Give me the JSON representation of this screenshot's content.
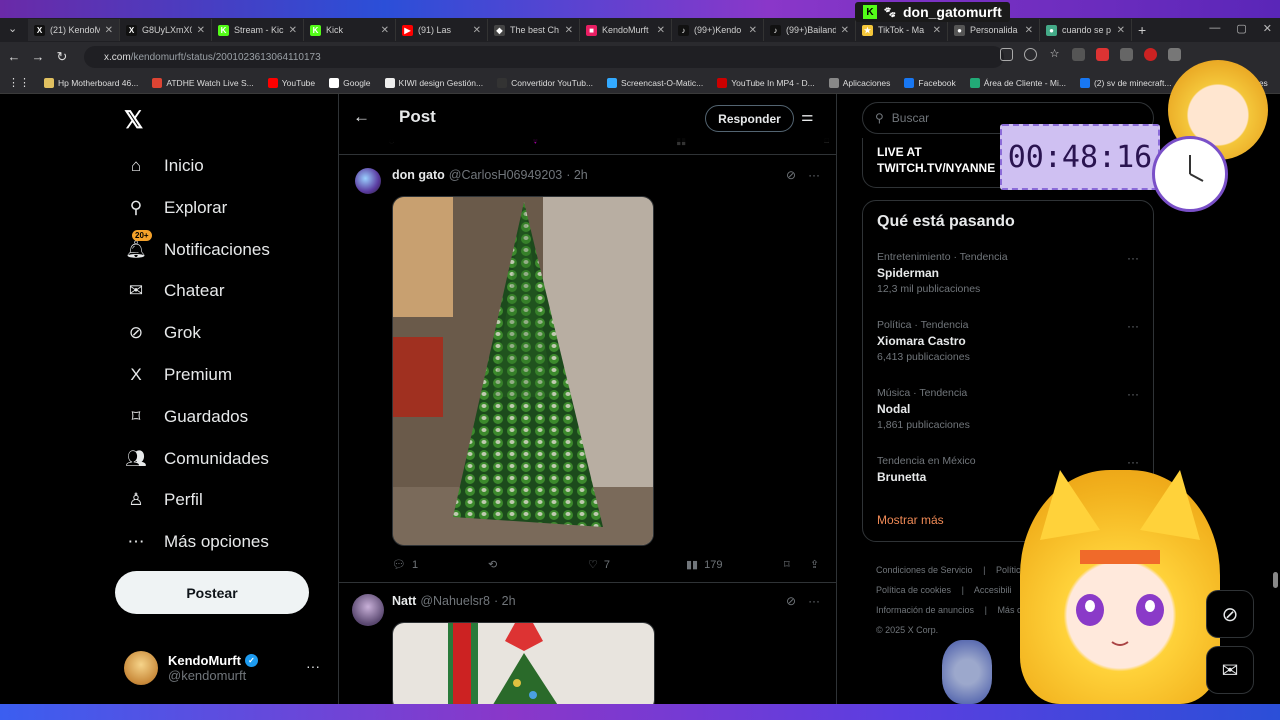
{
  "browser": {
    "tabs": [
      {
        "label": "(21) KendoM",
        "fav_color": "#111",
        "fav_glyph": "X"
      },
      {
        "label": "G8UyLXmX0",
        "fav_color": "#111",
        "fav_glyph": "X"
      },
      {
        "label": "Stream - Kick",
        "fav_color": "#53fc18",
        "fav_glyph": "K"
      },
      {
        "label": "Kick",
        "fav_color": "#53fc18",
        "fav_glyph": "K"
      },
      {
        "label": "(91) Las",
        "fav_color": "#ff0000",
        "fav_glyph": "▶"
      },
      {
        "label": "The best Ch",
        "fav_color": "#444",
        "fav_glyph": "◆"
      },
      {
        "label": "KendoMurft",
        "fav_color": "#e91e63",
        "fav_glyph": "■"
      },
      {
        "label": "(99+)Kendo",
        "fav_color": "#111",
        "fav_glyph": "♪"
      },
      {
        "label": "(99+)Bailand",
        "fav_color": "#111",
        "fav_glyph": "♪"
      },
      {
        "label": "TikTok - Ma",
        "fav_color": "#f4c63a",
        "fav_glyph": "★"
      },
      {
        "label": "Personalida",
        "fav_color": "#555",
        "fav_glyph": "●"
      },
      {
        "label": "cuando se p",
        "fav_color": "#4a8",
        "fav_glyph": "●"
      }
    ],
    "url_host": "x.com",
    "url_path": "/kendomurft/status/2001023613064110173",
    "bookmarks": [
      {
        "label": "Hp Motherboard 46...",
        "color": "#e0c060"
      },
      {
        "label": "ATDHE Watch Live S...",
        "color": "#d43"
      },
      {
        "label": "YouTube",
        "color": "#f00"
      },
      {
        "label": "Google",
        "color": "#fff"
      },
      {
        "label": "KIWI design Gestión...",
        "color": "#eee"
      },
      {
        "label": "Convertidor YouTub...",
        "color": "#333"
      },
      {
        "label": "Screencast-O-Matic...",
        "color": "#3af"
      },
      {
        "label": "YouTube In MP4 - D...",
        "color": "#c00"
      },
      {
        "label": "Aplicaciones",
        "color": "#888"
      },
      {
        "label": "Facebook",
        "color": "#1877f2"
      },
      {
        "label": "Área de Cliente - Mi...",
        "color": "#2a7"
      },
      {
        "label": "(2) sv de minecraft...",
        "color": "#1877f2"
      }
    ],
    "bookmark_overflow": "»",
    "bookmark_end": "cadores"
  },
  "stream_overlay": {
    "username": "don_gatomurft",
    "timer": "00:48:16"
  },
  "nav": {
    "items": [
      {
        "label": "Inicio",
        "icon": "home-icon",
        "glyph": "⌂"
      },
      {
        "label": "Explorar",
        "icon": "search-icon",
        "glyph": "⚲"
      },
      {
        "label": "Notificaciones",
        "icon": "bell-icon",
        "glyph": "🔔︎",
        "badge": "20+"
      },
      {
        "label": "Chatear",
        "icon": "mail-icon",
        "glyph": "✉"
      },
      {
        "label": "Grok",
        "icon": "grok-icon",
        "glyph": "⊘"
      },
      {
        "label": "Premium",
        "icon": "x-icon",
        "glyph": "X"
      },
      {
        "label": "Guardados",
        "icon": "bookmark-icon",
        "glyph": "⌑"
      },
      {
        "label": "Comunidades",
        "icon": "people-icon",
        "glyph": "👥︎"
      },
      {
        "label": "Perfil",
        "icon": "person-icon",
        "glyph": "♙"
      },
      {
        "label": "Más opciones",
        "icon": "more-circle-icon",
        "glyph": "⋯"
      }
    ],
    "badge": "20+",
    "post_button": "Postear",
    "account_name": "KendoMurft",
    "account_handle": "@kendomurft"
  },
  "header": {
    "title": "Post",
    "reply_button": "Responder"
  },
  "tweets": [
    {
      "name": "don gato",
      "handle": "@CarlosH06949203",
      "time": "· 2h",
      "replies": "1",
      "retweets": "",
      "likes": "7",
      "views": "179"
    },
    {
      "name": "Natt",
      "handle": "@Nahuelsr8",
      "time": "· 2h"
    }
  ],
  "search": {
    "placeholder": "Buscar"
  },
  "live_box": {
    "line1": "LIVE AT",
    "line2": "TWITCH.TV/NYANNE"
  },
  "trends": {
    "title": "Qué está pasando",
    "items": [
      {
        "category": "Entretenimiento · Tendencia",
        "name": "Spiderman",
        "count": "12,3 mil publicaciones"
      },
      {
        "category": "Política · Tendencia",
        "name": "Xiomara Castro",
        "count": "6,413 publicaciones"
      },
      {
        "category": "Música · Tendencia",
        "name": "Nodal",
        "count": "1,861 publicaciones"
      },
      {
        "category": "Tendencia en México",
        "name": "Brunetta",
        "count": ""
      }
    ],
    "show_more": "Mostrar más"
  },
  "footer": {
    "links": [
      "Condiciones de Servicio",
      "|",
      "Política de",
      "Política de cookies",
      "|",
      "Accesibili",
      "Información de anuncios",
      "|",
      "Más o"
    ],
    "copyright": "© 2025 X Corp."
  },
  "colors": {
    "accent_orange": "#f08a56",
    "verified": "#1d9bf0",
    "background": "#000000"
  }
}
